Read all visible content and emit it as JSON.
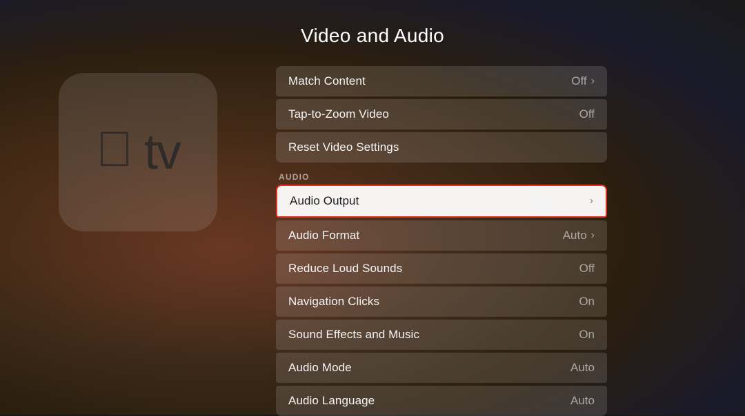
{
  "page": {
    "title": "Video and Audio"
  },
  "sections": {
    "video_section_label": "",
    "audio_section_label": "AUDIO"
  },
  "video_rows": [
    {
      "id": "match-content",
      "label": "Match Content",
      "value": "Off",
      "hasChevron": true
    },
    {
      "id": "tap-to-zoom",
      "label": "Tap-to-Zoom Video",
      "value": "Off",
      "hasChevron": false
    },
    {
      "id": "reset-video",
      "label": "Reset Video Settings",
      "value": "",
      "hasChevron": false
    }
  ],
  "audio_rows": [
    {
      "id": "audio-output",
      "label": "Audio Output",
      "value": "",
      "hasChevron": true,
      "selected": true
    },
    {
      "id": "audio-format",
      "label": "Audio Format",
      "value": "Auto",
      "hasChevron": true
    },
    {
      "id": "reduce-loud",
      "label": "Reduce Loud Sounds",
      "value": "Off",
      "hasChevron": false
    },
    {
      "id": "nav-clicks",
      "label": "Navigation Clicks",
      "value": "On",
      "hasChevron": false
    },
    {
      "id": "sound-effects",
      "label": "Sound Effects and Music",
      "value": "On",
      "hasChevron": false
    },
    {
      "id": "audio-mode",
      "label": "Audio Mode",
      "value": "Auto",
      "hasChevron": false
    },
    {
      "id": "audio-language",
      "label": "Audio Language",
      "value": "Auto",
      "hasChevron": false
    }
  ],
  "icons": {
    "chevron": "›",
    "apple_symbol": ""
  }
}
